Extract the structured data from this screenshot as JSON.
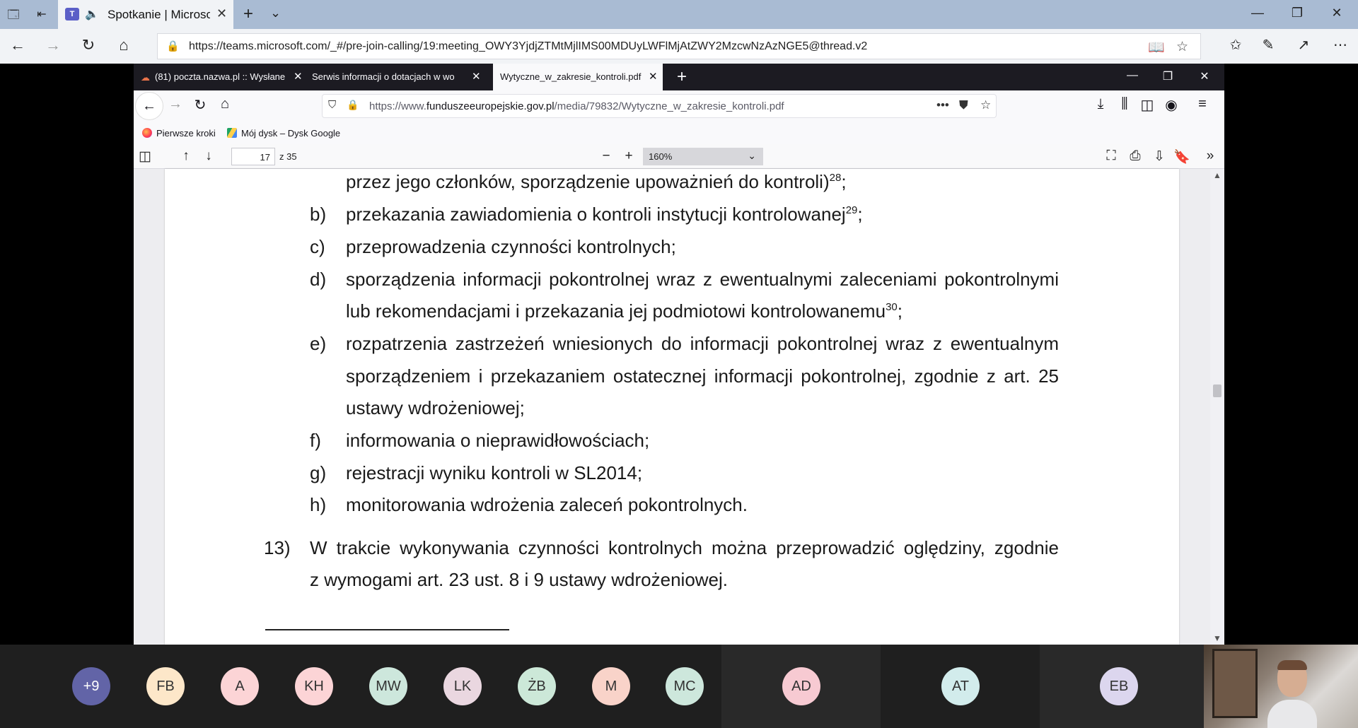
{
  "edge": {
    "tab_title": "Spotkanie | Microsc",
    "url": "https://teams.microsoft.com/_#/pre-join-calling/19:meeting_OWY3YjdjZTMtMjlIMS00MDUyLWFlMjAtZWY2MzcwNzAzNGE5@thread.v2"
  },
  "firefox": {
    "tabs": [
      {
        "label": "(81) poczta.nazwa.pl :: Wysłane"
      },
      {
        "label": "Serwis informacji o dotacjach w wo"
      },
      {
        "label": "Wytyczne_w_zakresie_kontroli.pdf"
      }
    ],
    "url_prefix": "https://www.",
    "url_domain": "funduszeeuropejskie.gov.pl",
    "url_path": "/media/79832/Wytyczne_w_zakresie_kontroli.pdf",
    "url_more": "•••",
    "bookmarks": [
      {
        "label": "Pierwsze kroki"
      },
      {
        "label": "Mój dysk – Dysk Google"
      }
    ]
  },
  "pdf": {
    "page_number": "17",
    "page_total": "z 35",
    "zoom": "160%",
    "lines": {
      "l0": "przez jego członków, sporządzenie upoważnień do kontroli)",
      "l0_sup": "28",
      "l0_end": ";",
      "b_label": "b)",
      "b_text": "przekazania zawiadomienia o kontroli instytucji kontrolowanej",
      "b_sup": "29",
      "b_end": ";",
      "c_label": "c)",
      "c_text": "przeprowadzenia czynności kontrolnych;",
      "d_label": "d)",
      "d_text1": "sporządzenia informacji pokontrolnej wraz z ewentualnymi zaleceniami pokontrolnymi",
      "d_text2": "lub rekomendacjami i przekazania jej podmiotowi kontrolowanemu",
      "d_sup": "30",
      "d_end": ";",
      "e_label": "e)",
      "e_text1": "rozpatrzenia zastrzeżeń wniesionych do informacji pokontrolnej wraz z ewentualnym",
      "e_text2": "sporządzeniem i przekazaniem ostatecznej informacji pokontrolnej, zgodnie z art. 25",
      "e_text3": "ustawy wdrożeniowej;",
      "f_label": "f)",
      "f_text": "informowania o nieprawidłowościach;",
      "g_label": "g)",
      "g_text": "rejestracji wyniku kontroli w SL2014;",
      "h_label": "h)",
      "h_text": "monitorowania wdrożenia zaleceń pokontrolnych.",
      "p13_label": "13)",
      "p13_text1": "W trakcie wykonywania czynności kontrolnych można przeprowadzić oględziny, zgodnie",
      "p13_text2": "z wymogami art. 23 ust. 8 i 9 ustawy wdrożeniowej."
    }
  },
  "participants": [
    {
      "initials": "+9",
      "bg": "#6264a7",
      "fg": "#ffffff"
    },
    {
      "initials": "FB",
      "bg": "#fde7c9",
      "fg": "#333333"
    },
    {
      "initials": "A",
      "bg": "#fcd4d6",
      "fg": "#333333"
    },
    {
      "initials": "KH",
      "bg": "#fcd4d6",
      "fg": "#333333"
    },
    {
      "initials": "MW",
      "bg": "#cde7dc",
      "fg": "#333333"
    },
    {
      "initials": "LK",
      "bg": "#ead7e0",
      "fg": "#333333"
    },
    {
      "initials": "ŻB",
      "bg": "#cce8d8",
      "fg": "#333333"
    },
    {
      "initials": "M",
      "bg": "#f9d3c9",
      "fg": "#333333"
    },
    {
      "initials": "MC",
      "bg": "#cde7dc",
      "fg": "#333333"
    },
    {
      "initials": "AD",
      "bg": "#f7cad2",
      "fg": "#333333"
    },
    {
      "initials": "AT",
      "bg": "#d2ecec",
      "fg": "#333333"
    },
    {
      "initials": "EB",
      "bg": "#dcd6ee",
      "fg": "#333333"
    }
  ]
}
